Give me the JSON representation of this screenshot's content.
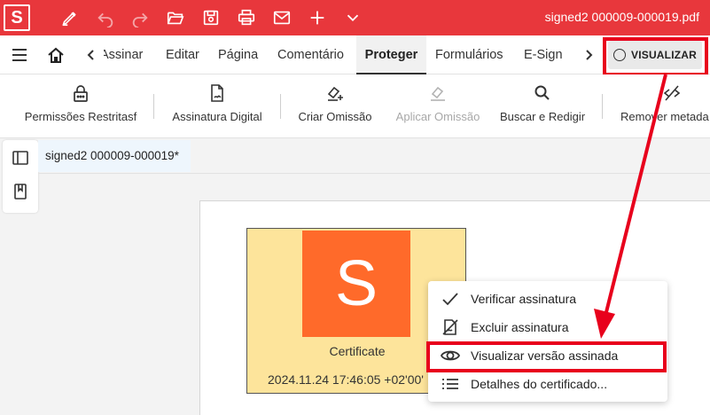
{
  "titlebar": {
    "logo": "S",
    "doc_title": "signed2 000009-000019.pdf",
    "quick_actions": [
      "pen-icon",
      "undo-icon",
      "redo-icon",
      "folder-open-icon",
      "save-icon",
      "print-icon",
      "mail-icon",
      "plus-icon",
      "chevron-down-icon"
    ],
    "bg_color": "#e8373c"
  },
  "menubar": {
    "items": [
      {
        "label": "Assinar"
      },
      {
        "label": "Editar"
      },
      {
        "label": "Página"
      },
      {
        "label": "Comentário"
      },
      {
        "label": "Proteger"
      },
      {
        "label": "Formulários"
      },
      {
        "label": "E-Sign"
      }
    ],
    "active": "Proteger",
    "visualizar_label": "VISUALIZAR"
  },
  "ribbon": {
    "buttons": [
      {
        "label": "Permissões Restritasf",
        "icon": "lock-icon",
        "disabled": false
      },
      {
        "label": "Assinatura Digital",
        "icon": "signed-document-icon",
        "disabled": false
      },
      {
        "label": "Criar Omissão",
        "icon": "redact-create-icon",
        "disabled": false
      },
      {
        "label": "Aplicar Omissão",
        "icon": "redact-apply-icon",
        "disabled": true
      },
      {
        "label": "Buscar e Redigir",
        "icon": "search-icon",
        "disabled": false
      },
      {
        "label": "Remover metada",
        "icon": "remove-metadata-icon",
        "disabled": false
      }
    ]
  },
  "doc_tab": {
    "title": "signed2 000009-000019*"
  },
  "certificate": {
    "logo_letter": "S",
    "label": "Certificate",
    "date": "2024.11.24 17:46:05 +02'00'",
    "bg_color": "#fde49b",
    "logo_color": "#ff6a2a"
  },
  "context_menu": {
    "items": [
      {
        "label": "Verificar assinatura",
        "icon": "checkmark-icon"
      },
      {
        "label": "Excluir assinatura",
        "icon": "delete-signature-icon"
      },
      {
        "label": "Visualizar versão assinada",
        "icon": "eye-icon"
      },
      {
        "label": "Detalhes do certificado...",
        "icon": "list-icon"
      }
    ],
    "highlighted": "Visualizar versão assinada"
  },
  "annotation": {
    "color": "#e8001c"
  }
}
